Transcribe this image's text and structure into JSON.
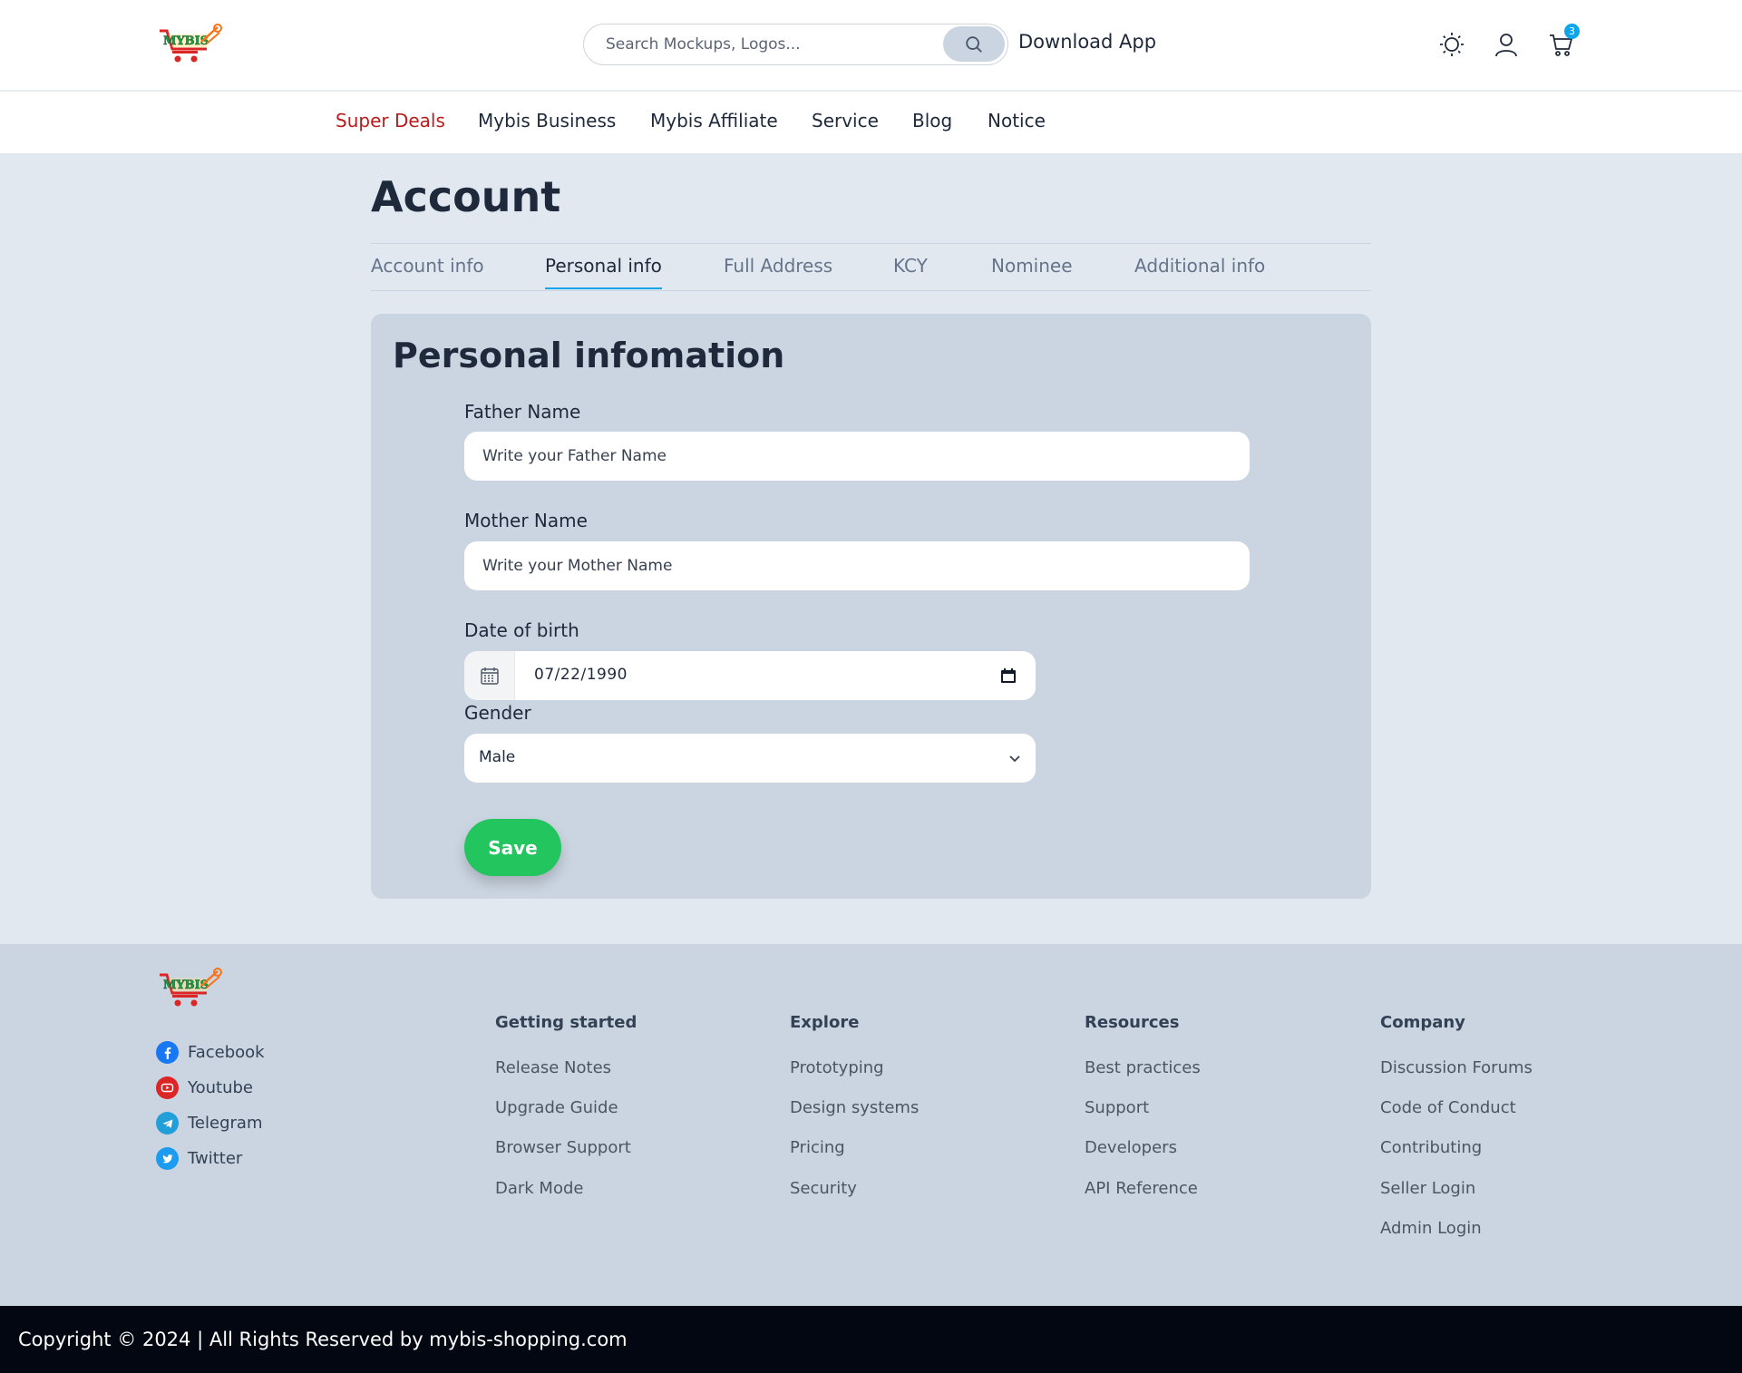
{
  "header": {
    "search_placeholder": "Search Mockups, Logos...",
    "download_label": "Download App",
    "cart_count": "3"
  },
  "nav": {
    "items": [
      "Super Deals",
      "Mybis Business",
      "Mybis Affiliate",
      "Service",
      "Blog",
      "Notice"
    ]
  },
  "page": {
    "title": "Account",
    "tabs": [
      "Account info",
      "Personal info",
      "Full Address",
      "KCY",
      "Nominee",
      "Additional info"
    ],
    "active_tab": "Personal info"
  },
  "form": {
    "title": "Personal infomation",
    "father_label": "Father Name",
    "father_placeholder": "Write your Father Name",
    "mother_label": "Mother Name",
    "mother_placeholder": "Write your Mother Name",
    "dob_label": "Date of birth",
    "dob_value": "07/22/1990",
    "gender_label": "Gender",
    "gender_value": "Male",
    "save_label": "Save"
  },
  "footer": {
    "social": [
      "Facebook",
      "Youtube",
      "Telegram",
      "Twitter"
    ],
    "columns": [
      {
        "heading": "Getting started",
        "links": [
          "Release Notes",
          "Upgrade Guide",
          "Browser Support",
          "Dark Mode"
        ]
      },
      {
        "heading": "Explore",
        "links": [
          "Prototyping",
          "Design systems",
          "Pricing",
          "Security"
        ]
      },
      {
        "heading": "Resources",
        "links": [
          "Best practices",
          "Support",
          "Developers",
          "API Reference"
        ]
      },
      {
        "heading": "Company",
        "links": [
          "Discussion Forums",
          "Code of Conduct",
          "Contributing",
          "Seller Login",
          "Admin Login"
        ]
      }
    ],
    "copyright": "Copyright © 2024 | All Rights Reserved by mybis-shopping.com"
  },
  "colors": {
    "accent": "#0ea5e9",
    "deal_red": "#b91c1c",
    "save_green": "#22c55e",
    "footer_bg": "#cbd5e1",
    "bottom_bar": "#030712"
  }
}
